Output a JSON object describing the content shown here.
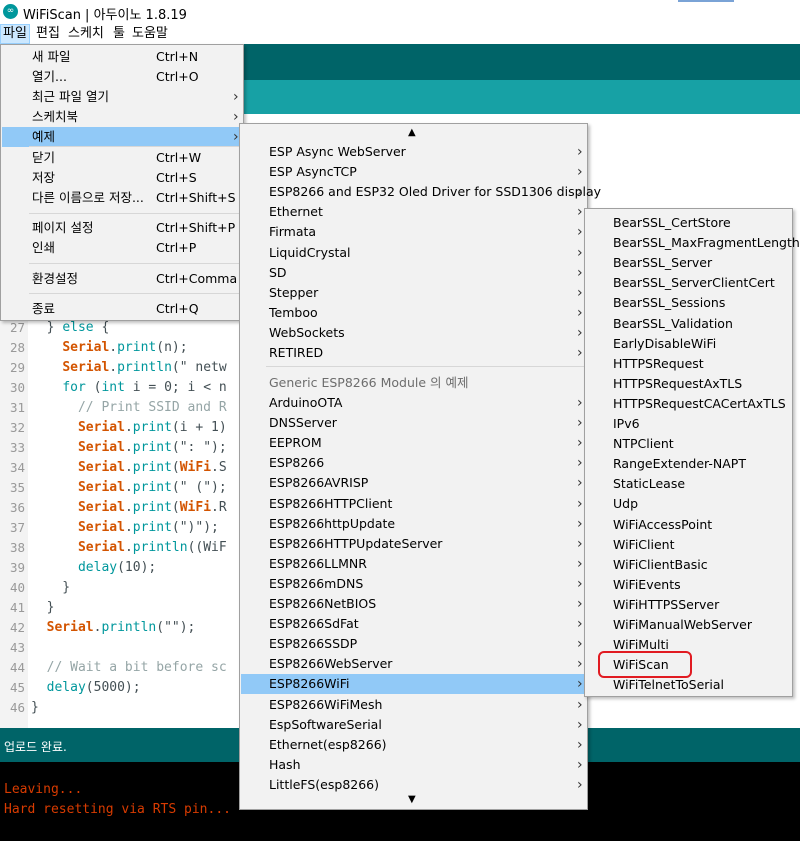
{
  "window": {
    "title": "WiFiScan | 아두이노 1.8.19",
    "icon": "arduino-logo-icon"
  },
  "menubar": [
    "파일",
    "편집",
    "스케치",
    "툴",
    "도움말"
  ],
  "file_menu": {
    "items": [
      {
        "label": "새 파일",
        "shortcut": "Ctrl+N"
      },
      {
        "label": "열기...",
        "shortcut": "Ctrl+O"
      },
      {
        "label": "최근 파일 열기",
        "shortcut": "",
        "submenu": true
      },
      {
        "label": "스케치북",
        "shortcut": "",
        "submenu": true
      },
      {
        "label": "예제",
        "shortcut": "",
        "submenu": true,
        "highlighted": true
      },
      {
        "label": "닫기",
        "shortcut": "Ctrl+W"
      },
      {
        "label": "저장",
        "shortcut": "Ctrl+S"
      },
      {
        "label": "다른 이름으로 저장...",
        "shortcut": "Ctrl+Shift+S"
      },
      {
        "label": "페이지 설정",
        "shortcut": "Ctrl+Shift+P"
      },
      {
        "label": "인쇄",
        "shortcut": "Ctrl+P"
      },
      {
        "label": "환경설정",
        "shortcut": "Ctrl+Comma"
      },
      {
        "label": "종료",
        "shortcut": "Ctrl+Q"
      }
    ]
  },
  "examples_menu": {
    "top_items": [
      "ESP Async WebServer",
      "ESP AsyncTCP",
      "ESP8266 and ESP32 Oled Driver for SSD1306 display",
      "Ethernet",
      "Firmata",
      "LiquidCrystal",
      "SD",
      "Stepper",
      "Temboo",
      "WebSockets",
      "RETIRED"
    ],
    "board_header": "Generic ESP8266 Module 의 예제",
    "board_items": [
      "ArduinoOTA",
      "DNSServer",
      "EEPROM",
      "ESP8266",
      "ESP8266AVRISP",
      "ESP8266HTTPClient",
      "ESP8266httpUpdate",
      "ESP8266HTTPUpdateServer",
      "ESP8266LLMNR",
      "ESP8266mDNS",
      "ESP8266NetBIOS",
      "ESP8266SdFat",
      "ESP8266SSDP",
      "ESP8266WebServer",
      "ESP8266WiFi",
      "ESP8266WiFiMesh",
      "EspSoftwareSerial",
      "Ethernet(esp8266)",
      "Hash",
      "LittleFS(esp8266)"
    ],
    "highlighted": "ESP8266WiFi"
  },
  "wifi_menu": {
    "items": [
      "BearSSL_CertStore",
      "BearSSL_MaxFragmentLength",
      "BearSSL_Server",
      "BearSSL_ServerClientCert",
      "BearSSL_Sessions",
      "BearSSL_Validation",
      "EarlyDisableWiFi",
      "HTTPSRequest",
      "HTTPSRequestAxTLS",
      "HTTPSRequestCACertAxTLS",
      "IPv6",
      "NTPClient",
      "RangeExtender-NAPT",
      "StaticLease",
      "Udp",
      "WiFiAccessPoint",
      "WiFiClient",
      "WiFiClientBasic",
      "WiFiEvents",
      "WiFiHTTPSServer",
      "WiFiManualWebServer",
      "WiFiMulti",
      "WiFiScan",
      "WiFiTelnetToSerial"
    ],
    "circled": "WiFiScan"
  },
  "code_lines": [
    {
      "n": "27",
      "t": "  } else {"
    },
    {
      "n": "28",
      "t": "    Serial.print(n);"
    },
    {
      "n": "29",
      "t": "    Serial.println(\" netw"
    },
    {
      "n": "30",
      "t": "    for (int i = 0; i < n"
    },
    {
      "n": "31",
      "t": "      // Print SSID and R"
    },
    {
      "n": "32",
      "t": "      Serial.print(i + 1)"
    },
    {
      "n": "33",
      "t": "      Serial.print(\": \");"
    },
    {
      "n": "34",
      "t": "      Serial.print(WiFi.S"
    },
    {
      "n": "35",
      "t": "      Serial.print(\" (\");"
    },
    {
      "n": "36",
      "t": "      Serial.print(WiFi.R"
    },
    {
      "n": "37",
      "t": "      Serial.print(\")\");"
    },
    {
      "n": "38",
      "t": "      Serial.println((WiF"
    },
    {
      "n": "39",
      "t": "      delay(10);"
    },
    {
      "n": "40",
      "t": "    }"
    },
    {
      "n": "41",
      "t": "  }"
    },
    {
      "n": "42",
      "t": "  Serial.println(\"\");"
    },
    {
      "n": "43",
      "t": ""
    },
    {
      "n": "44",
      "t": "  // Wait a bit before sc"
    },
    {
      "n": "45",
      "t": "  delay(5000);"
    },
    {
      "n": "46",
      "t": "}"
    }
  ],
  "status": {
    "message": "업로드 완료."
  },
  "console": {
    "lines": [
      "Leaving...",
      "Hard resetting via RTS pin..."
    ]
  },
  "colors": {
    "teal_dark": "#006468",
    "teal": "#17a1a5",
    "highlight": "#91c9f7",
    "circle": "#e11b22",
    "console_text": "#d83b01"
  }
}
